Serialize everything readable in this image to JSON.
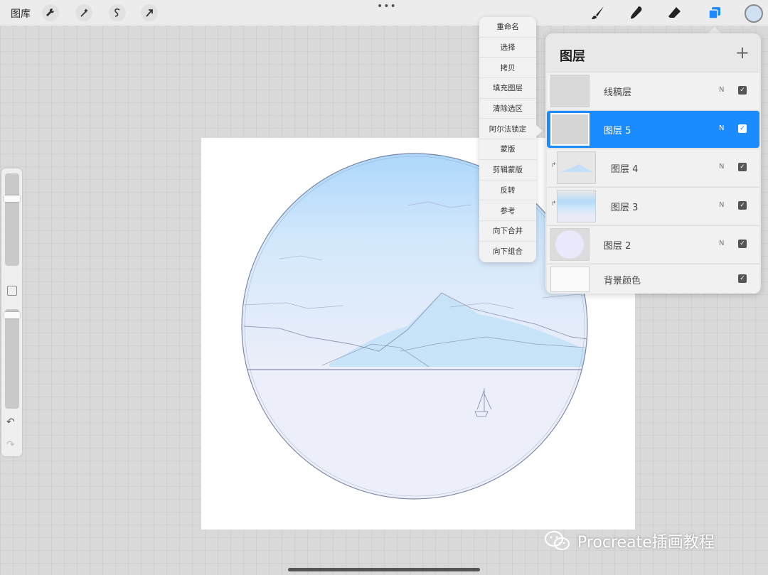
{
  "topbar": {
    "gallery_label": "图库",
    "left_tools": [
      {
        "name": "wrench-icon"
      },
      {
        "name": "magic-wand-icon"
      },
      {
        "name": "selection-s-icon"
      },
      {
        "name": "transform-arrow-icon"
      }
    ],
    "more_label": "•••",
    "right_tools": [
      {
        "name": "brush-icon"
      },
      {
        "name": "smudge-icon"
      },
      {
        "name": "eraser-icon"
      },
      {
        "name": "layers-icon",
        "active": true
      }
    ],
    "current_color": "#cfe0f2"
  },
  "sidebar": {
    "brush_size_level": 0.24,
    "opacity_level": 0.03
  },
  "action_menu": {
    "items": [
      "重命名",
      "选择",
      "拷贝",
      "填充图层",
      "清除选区",
      "阿尔法锁定",
      "蒙版",
      "剪辑蒙版",
      "反转",
      "参考",
      "向下合并",
      "向下组合"
    ]
  },
  "layers_panel": {
    "title": "图层",
    "add_label": "+",
    "layers": [
      {
        "name": "线稿层",
        "blend": "N",
        "visible": true,
        "active": false,
        "clipped": false
      },
      {
        "name": "图层 5",
        "blend": "N",
        "visible": true,
        "active": true,
        "clipped": false
      },
      {
        "name": "图层 4",
        "blend": "N",
        "visible": true,
        "active": false,
        "clipped": true
      },
      {
        "name": "图层 3",
        "blend": "N",
        "visible": true,
        "active": false,
        "clipped": true
      },
      {
        "name": "图层 2",
        "blend": "N",
        "visible": true,
        "active": false,
        "clipped": false
      },
      {
        "name": "背景颜色",
        "blend": "",
        "visible": true,
        "active": false,
        "clipped": false
      }
    ]
  },
  "colors": {
    "accent": "#1a8cff",
    "sky_top": "#a9d6fb",
    "mountain": "#c8e4f8",
    "water": "#eceef9",
    "circle_outline": "#5a6688"
  },
  "watermark": {
    "text": "Procreate插画教程"
  }
}
